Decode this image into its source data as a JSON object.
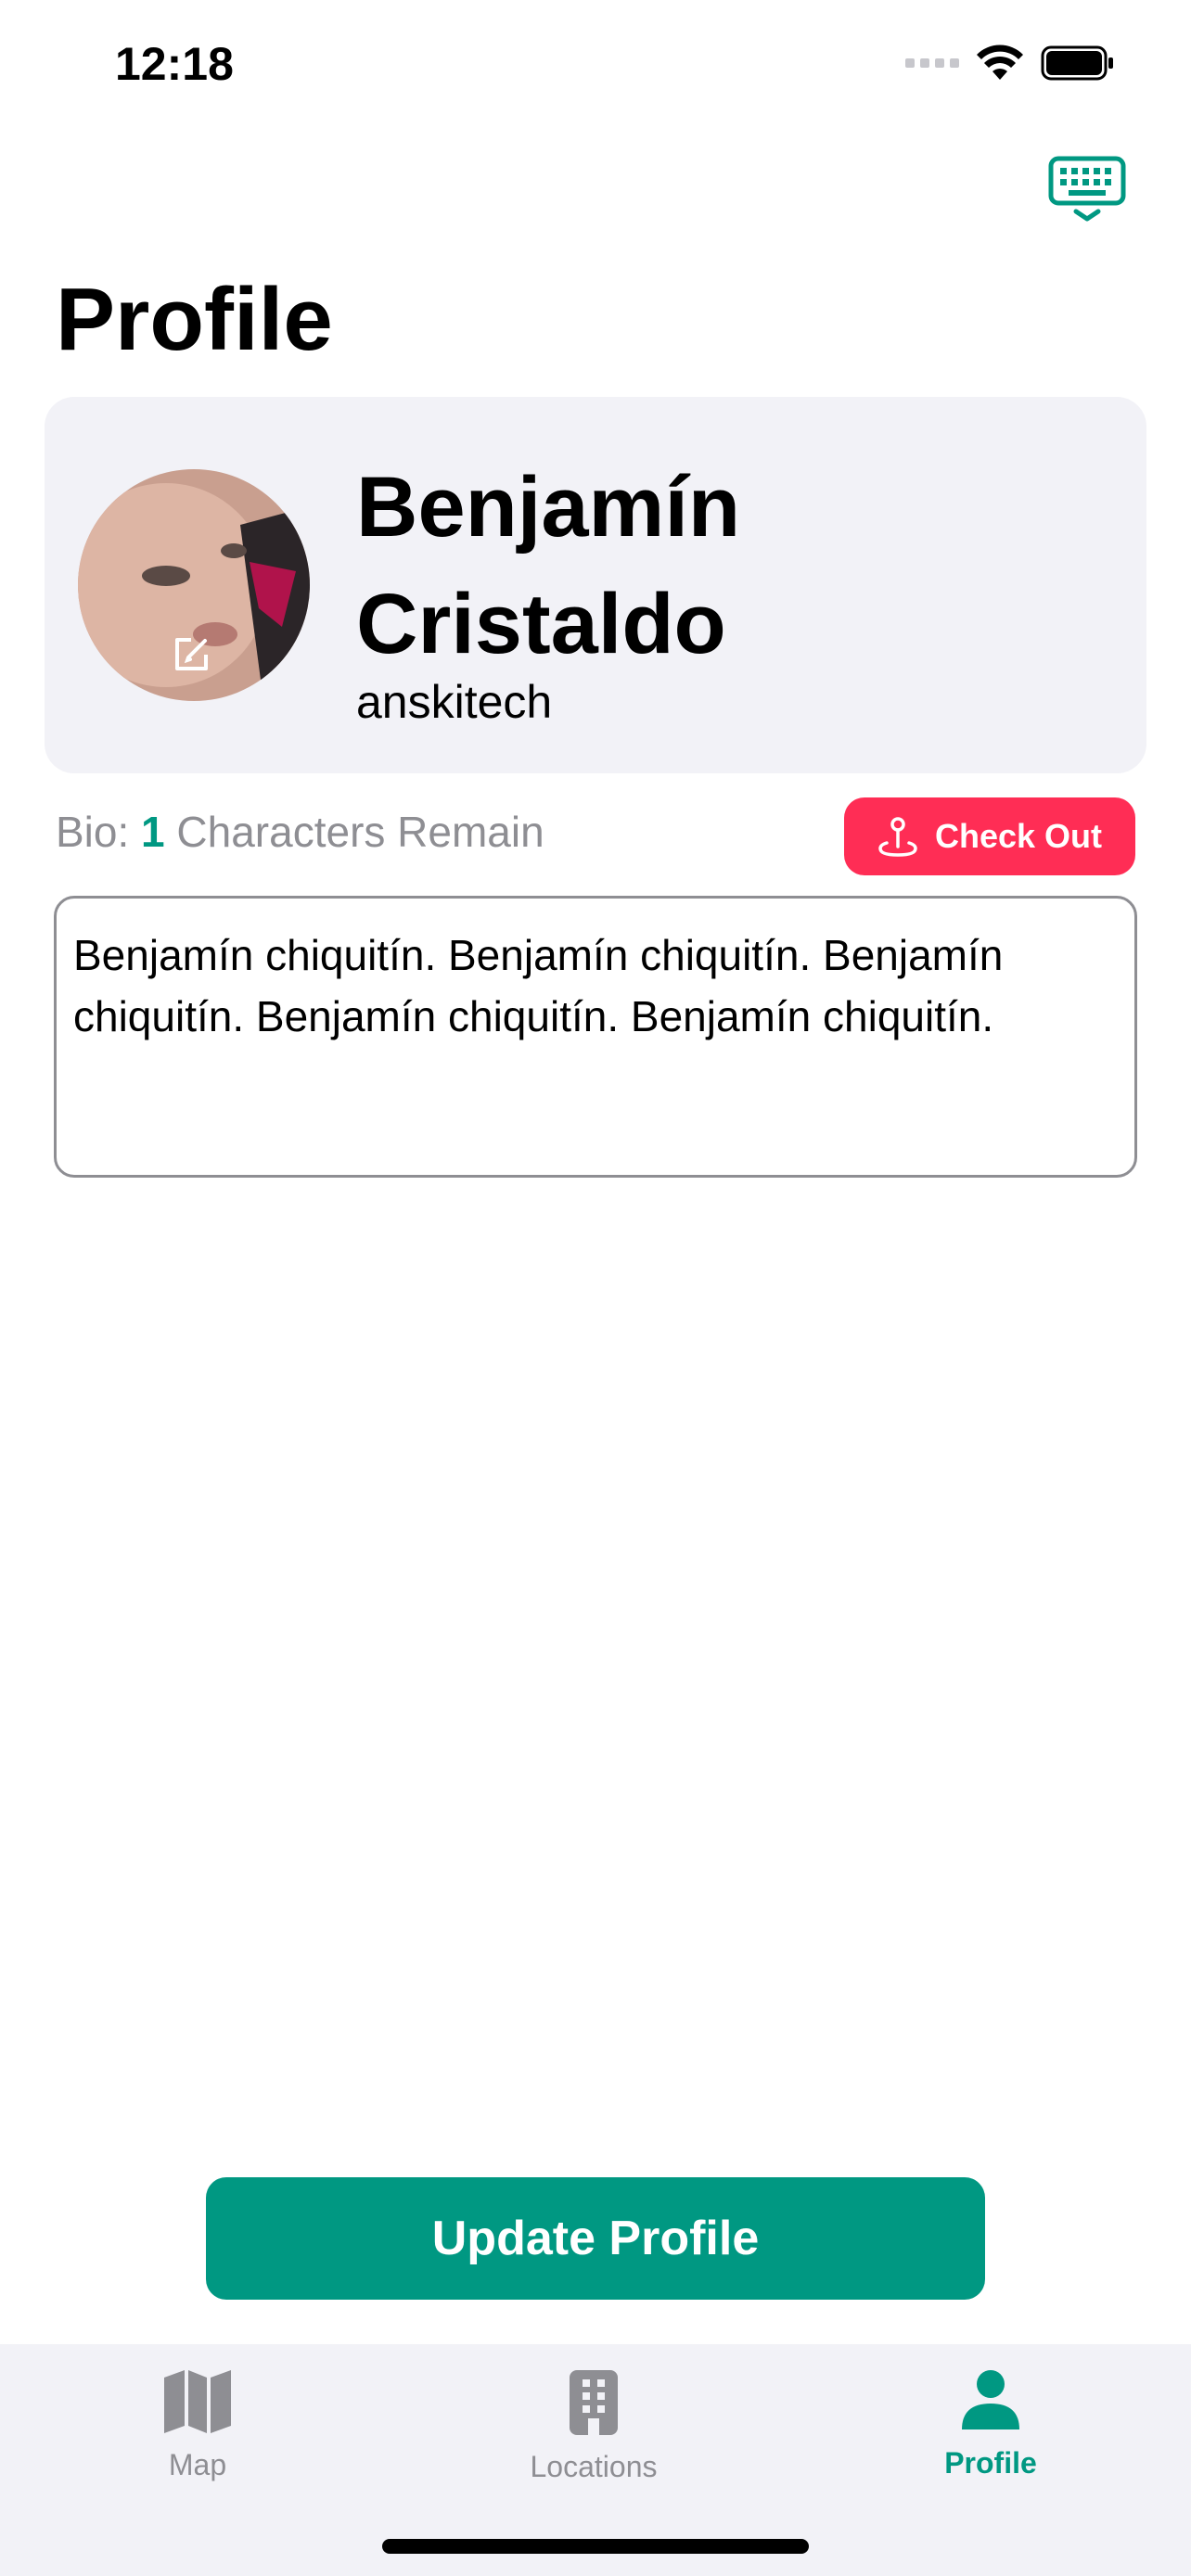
{
  "status": {
    "time": "12:18"
  },
  "page": {
    "title": "Profile"
  },
  "profile": {
    "name_line1": "Benjamín",
    "name_line2": "Cristaldo",
    "username": "anskitech"
  },
  "bio": {
    "label": "Bio:",
    "remaining": "1",
    "remaining_suffix": "Characters Remain",
    "text": "Benjamín chiquitín. Benjamín chiquitín. Benjamín chiquitín. Benjamín chiquitín. Benjamín chiquitín."
  },
  "checkout": {
    "label": "Check Out"
  },
  "actions": {
    "update_label": "Update Profile"
  },
  "tabs": [
    {
      "label": "Map",
      "icon": "map-icon",
      "active": false
    },
    {
      "label": "Locations",
      "icon": "building-icon",
      "active": false
    },
    {
      "label": "Profile",
      "icon": "person-icon",
      "active": true
    }
  ],
  "colors": {
    "accent": "#009882",
    "danger": "#ff2d55",
    "card": "#f2f2f7"
  }
}
